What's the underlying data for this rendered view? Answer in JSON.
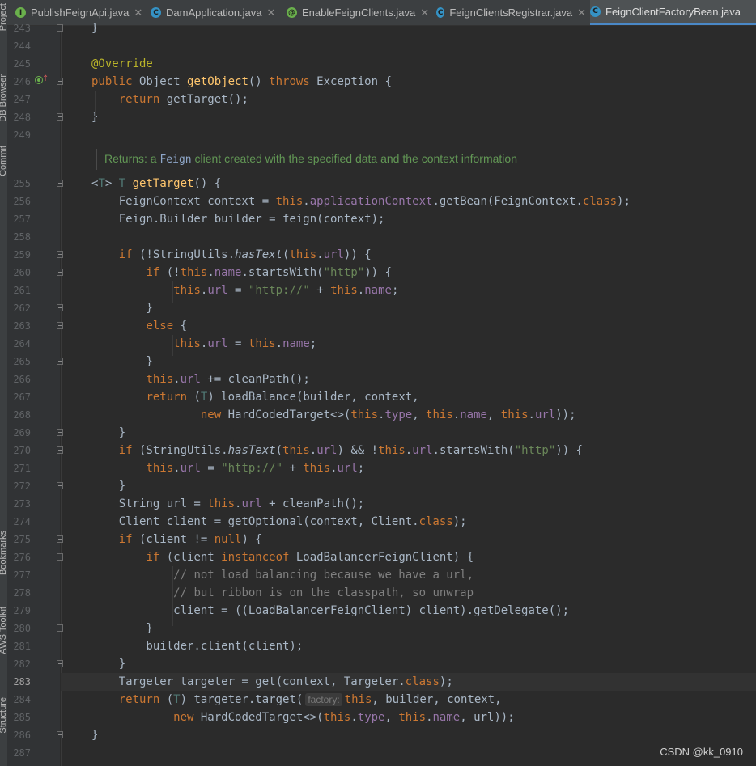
{
  "tabs": [
    {
      "label": "PublishFeignApi.java",
      "icon": "I",
      "color": "#6ab04c",
      "close": "✕",
      "active": false
    },
    {
      "label": "DamApplication.java",
      "icon": "C",
      "color": "#3592c4",
      "close": "✕",
      "active": false
    },
    {
      "label": "EnableFeignClients.java",
      "icon": "@",
      "color": "#6ab04c",
      "close": "✕",
      "active": false
    },
    {
      "label": "FeignClientsRegistrar.java",
      "icon": "C",
      "color": "#3592c4",
      "close": "✕",
      "active": false
    },
    {
      "label": "FeignClientFactoryBean.java",
      "icon": "C",
      "color": "#3592c4",
      "close": "",
      "active": true
    }
  ],
  "side_labels": {
    "project": "Project",
    "db_browser": "DB Browser",
    "commit": "Commit",
    "bookmarks": "Bookmarks",
    "aws_toolkit": "AWS Toolkit",
    "structure": "Structure"
  },
  "doc_comment": {
    "before": "Returns: a",
    "mono": "Feign",
    "after": "client created with the specified data and the context information"
  },
  "hint_label": "factory:",
  "current_line": 283,
  "lines": [
    {
      "n": 243,
      "fold": true,
      "html": "<span>}</span>"
    },
    {
      "n": 244,
      "fold": false,
      "html": ""
    },
    {
      "n": 245,
      "fold": false,
      "html": "<span class='ann'>@Override</span>"
    },
    {
      "n": 246,
      "fold": true,
      "html": "<span class='kw'>public</span> Object <span class='fn'>getObject</span>() <span class='kw'>throws</span> Exception {"
    },
    {
      "n": 247,
      "fold": false,
      "html": "    <span class='kw'>return</span> getTarget();"
    },
    {
      "n": 248,
      "fold": true,
      "html": "}"
    },
    {
      "n": 249,
      "fold": false,
      "html": ""
    },
    {
      "n": 255,
      "fold": true,
      "html": "&lt;<span class='tp'>T</span>&gt; <span class='tp'>T</span> <span class='fn'>getTarget</span>() {"
    },
    {
      "n": 256,
      "fold": false,
      "html": "    FeignContext context = <span class='kw'>this</span>.<span class='fld'>applicationContext</span>.getBean(FeignContext.<span class='kw'>class</span>);"
    },
    {
      "n": 257,
      "fold": false,
      "html": "    Feign.Builder builder = feign(context);"
    },
    {
      "n": 258,
      "fold": false,
      "html": ""
    },
    {
      "n": 259,
      "fold": true,
      "html": "    <span class='kw'>if</span> (!StringUtils.<span class='ital'>hasText</span>(<span class='kw'>this</span>.<span class='fld'>url</span>)) {"
    },
    {
      "n": 260,
      "fold": true,
      "html": "        <span class='kw'>if</span> (!<span class='kw'>this</span>.<span class='fld'>name</span>.startsWith(<span class='str'>\"http\"</span>)) {"
    },
    {
      "n": 261,
      "fold": false,
      "html": "            <span class='kw'>this</span>.<span class='fld'>url</span> = <span class='str'>\"http://\"</span> + <span class='kw'>this</span>.<span class='fld'>name</span>;"
    },
    {
      "n": 262,
      "fold": true,
      "html": "        }"
    },
    {
      "n": 263,
      "fold": true,
      "html": "        <span class='kw'>else</span> {"
    },
    {
      "n": 264,
      "fold": false,
      "html": "            <span class='kw'>this</span>.<span class='fld'>url</span> = <span class='kw'>this</span>.<span class='fld'>name</span>;"
    },
    {
      "n": 265,
      "fold": true,
      "html": "        }"
    },
    {
      "n": 266,
      "fold": false,
      "html": "        <span class='kw'>this</span>.<span class='fld'>url</span> += cleanPath();"
    },
    {
      "n": 267,
      "fold": false,
      "html": "        <span class='kw'>return</span> (<span class='tp'>T</span>) loadBalance(builder, context,"
    },
    {
      "n": 268,
      "fold": false,
      "html": "                <span class='kw'>new</span> HardCodedTarget&lt;&gt;(<span class='kw'>this</span>.<span class='fld'>type</span>, <span class='kw'>this</span>.<span class='fld'>name</span>, <span class='kw'>this</span>.<span class='fld'>url</span>));"
    },
    {
      "n": 269,
      "fold": true,
      "html": "    }"
    },
    {
      "n": 270,
      "fold": true,
      "html": "    <span class='kw'>if</span> (StringUtils.<span class='ital'>hasText</span>(<span class='kw'>this</span>.<span class='fld'>url</span>) &amp;&amp; !<span class='kw'>this</span>.<span class='fld'>url</span>.startsWith(<span class='str'>\"http\"</span>)) {"
    },
    {
      "n": 271,
      "fold": false,
      "html": "        <span class='kw'>this</span>.<span class='fld'>url</span> = <span class='str'>\"http://\"</span> + <span class='kw'>this</span>.<span class='fld'>url</span>;"
    },
    {
      "n": 272,
      "fold": true,
      "html": "    }"
    },
    {
      "n": 273,
      "fold": false,
      "html": "    String url = <span class='kw'>this</span>.<span class='fld'>url</span> + cleanPath();"
    },
    {
      "n": 274,
      "fold": false,
      "html": "    Client client = getOptional(context, Client.<span class='kw'>class</span>);"
    },
    {
      "n": 275,
      "fold": true,
      "html": "    <span class='kw'>if</span> (client != <span class='kw'>null</span>) {"
    },
    {
      "n": 276,
      "fold": true,
      "html": "        <span class='kw'>if</span> (client <span class='kw'>instanceof</span> LoadBalancerFeignClient) {"
    },
    {
      "n": 277,
      "fold": false,
      "html": "            <span class='cmt'>// not load balancing because we have a url,</span>"
    },
    {
      "n": 278,
      "fold": false,
      "html": "            <span class='cmt'>// but ribbon is on the classpath, so unwrap</span>"
    },
    {
      "n": 279,
      "fold": false,
      "html": "            client = ((LoadBalancerFeignClient) client).getDelegate();"
    },
    {
      "n": 280,
      "fold": true,
      "html": "        }"
    },
    {
      "n": 281,
      "fold": false,
      "html": "        builder.client(client);"
    },
    {
      "n": 282,
      "fold": true,
      "html": "    }"
    },
    {
      "n": 283,
      "fold": false,
      "html": "    Targeter targeter = get(context, Targeter.<span class='kw'>class</span>);"
    },
    {
      "n": 284,
      "fold": false,
      "html": "    <span class='kw'>return</span> (<span class='tp'>T</span>) targeter.target(<span class='hint' data-hint='1'></span><span class='kw'>this</span>, builder, context,"
    },
    {
      "n": 285,
      "fold": false,
      "html": "            <span class='kw'>new</span> HardCodedTarget&lt;&gt;(<span class='kw'>this</span>.<span class='fld'>type</span>, <span class='kw'>this</span>.<span class='fld'>name</span>, url));"
    },
    {
      "n": 286,
      "fold": true,
      "html": "}"
    },
    {
      "n": 287,
      "fold": false,
      "html": ""
    }
  ],
  "watermark": "CSDN @kk_0910"
}
